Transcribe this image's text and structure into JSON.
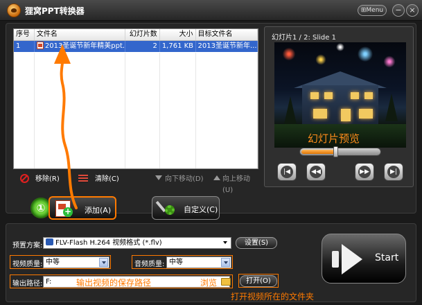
{
  "window": {
    "title": "狸窝PPT转换器",
    "menu_label": "Menu",
    "minimize_glyph": "−",
    "close_glyph": "×"
  },
  "file_list": {
    "columns": [
      "序号",
      "文件名",
      "幻灯片数",
      "大小",
      "目标文件名"
    ],
    "rows": [
      {
        "index": "1",
        "name": "2013圣诞节新年精美ppt...",
        "slides": "2",
        "size": "1,761 KB",
        "target": "2013圣诞节新年..."
      }
    ]
  },
  "list_toolbar": {
    "remove": "移除(R)",
    "clear": "清除(C)",
    "move_down": "向下移动(D)",
    "move_up": "向上移动(U)"
  },
  "preview": {
    "slide_label": "幻灯片1 / 2: Slide 1",
    "overlay_text": "幻灯片预览",
    "progress": 0.45,
    "controls": [
      "first",
      "previous",
      "next",
      "last"
    ]
  },
  "actions": {
    "step_badge": "①",
    "add_label": "添加(A)",
    "custom_label": "自定义(C)"
  },
  "settings": {
    "preset_label": "预置方案:",
    "preset_value": "FLV-Flash H.264 视频格式 (*.flv)",
    "settings_button": "设置(S)",
    "video_quality_label": "视频质量:",
    "video_quality_value": "中等",
    "audio_quality_label": "音频质量:",
    "audio_quality_value": "中等",
    "output_label": "输出路径:",
    "output_value": "F:",
    "output_hint": "输出视频的保存路径",
    "browse_label": "浏览",
    "open_button": "打开(O)",
    "open_hint": "打开视频所在的文件夹",
    "start_label": "Start"
  },
  "colors": {
    "accent": "#ff7a00",
    "selection": "#3366cc",
    "background": "#1a1a1a"
  },
  "icons": [
    "app-logo-icon",
    "ppt-file-icon",
    "remove-icon",
    "clear-icon",
    "arrow-down-icon",
    "arrow-up-icon",
    "add-file-icon",
    "tools-icon",
    "flv-format-icon",
    "folder-icon",
    "start-arrow-icon"
  ]
}
